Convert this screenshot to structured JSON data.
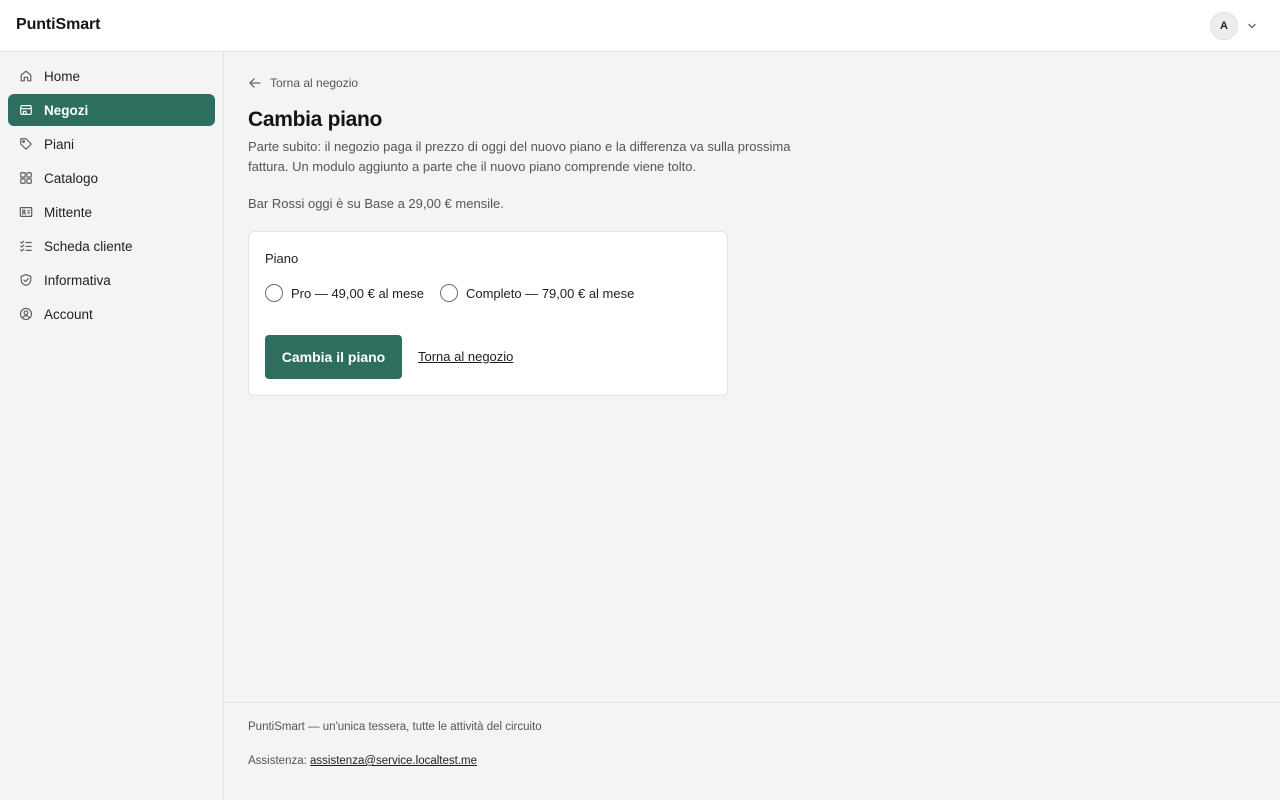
{
  "app": {
    "brand": "PuntiSmart"
  },
  "user": {
    "initial": "A",
    "icon": "chevron-down-icon"
  },
  "sidebar": {
    "items": [
      {
        "label": "Home",
        "icon": "home-icon",
        "active": false
      },
      {
        "label": "Negozi",
        "icon": "store-icon",
        "active": true
      },
      {
        "label": "Piani",
        "icon": "tag-icon",
        "active": false
      },
      {
        "label": "Catalogo",
        "icon": "grid-icon",
        "active": false
      },
      {
        "label": "Mittente",
        "icon": "id-card-icon",
        "active": false
      },
      {
        "label": "Scheda cliente",
        "icon": "checklist-icon",
        "active": false
      },
      {
        "label": "Informativa",
        "icon": "shield-icon",
        "active": false
      },
      {
        "label": "Account",
        "icon": "user-circle-icon",
        "active": false
      }
    ]
  },
  "main": {
    "back_label": "Torna al negozio",
    "title": "Cambia piano",
    "description": "Parte subito: il negozio paga il prezzo di oggi del nuovo piano e la differenza va sulla prossima fattura. Un modulo aggiunto a parte che il nuovo piano comprende viene tolto.",
    "current_plan": "Bar Rossi oggi è su Base a 29,00 € mensile.",
    "form": {
      "label": "Piano",
      "options": [
        {
          "label": "Pro — 49,00 € al mese",
          "selected": false
        },
        {
          "label": "Completo — 79,00 € al mese",
          "selected": false
        }
      ],
      "submit_label": "Cambia il piano",
      "cancel_label": "Torna al negozio"
    }
  },
  "footer": {
    "tagline": "PuntiSmart — un'unica tessera, tutte le attività del circuito",
    "support_label": "Assistenza:",
    "support_email": "assistenza@service.localtest.me"
  },
  "colors": {
    "accent": "#2e6e5e",
    "background": "#f4f4f4",
    "surface": "#ffffff"
  }
}
